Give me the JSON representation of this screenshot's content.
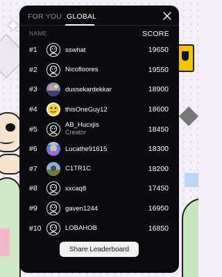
{
  "tabs": [
    {
      "label": "FOR YOU",
      "active": false
    },
    {
      "label": "GLOBAL",
      "active": true
    }
  ],
  "columns": {
    "name": "NAME",
    "score": "SCORE"
  },
  "rows": [
    {
      "rank": "#1",
      "name": "sswhat",
      "score": "19650",
      "avatar": "default-avatar-icon"
    },
    {
      "rank": "#2",
      "name": "Nicofloores",
      "score": "19550",
      "avatar": "default-avatar-icon"
    },
    {
      "rank": "#3",
      "name": "dussekardekkar",
      "score": "18900",
      "avatar": "photo-avatar"
    },
    {
      "rank": "#4",
      "name": "thisOneGuy12",
      "score": "18600",
      "avatar": "yellow-emoji-avatar"
    },
    {
      "rank": "#5",
      "name": "AB_Hucxjis",
      "role": "Creator",
      "score": "18450",
      "avatar": "default-avatar-icon"
    },
    {
      "rank": "#6",
      "name": "Lucathe91615",
      "score": "18300",
      "avatar": "photo-avatar"
    },
    {
      "rank": "#7",
      "name": "C1TR1C",
      "score": "18200",
      "avatar": "photo-avatar"
    },
    {
      "rank": "#8",
      "name": "xxcaq8",
      "score": "17450",
      "avatar": "default-avatar-icon"
    },
    {
      "rank": "#9",
      "name": "gaven1244",
      "score": "16950",
      "avatar": "default-avatar-icon"
    },
    {
      "rank": "#10",
      "name": "LOBAHOB",
      "score": "16850",
      "avatar": "default-avatar-icon"
    }
  ],
  "share_label": "Share Leaderboard",
  "colors": {
    "panel_bg": "#0b0b0d",
    "muted_text": "#8d8d92",
    "button_bg": "#f2f2f2"
  }
}
